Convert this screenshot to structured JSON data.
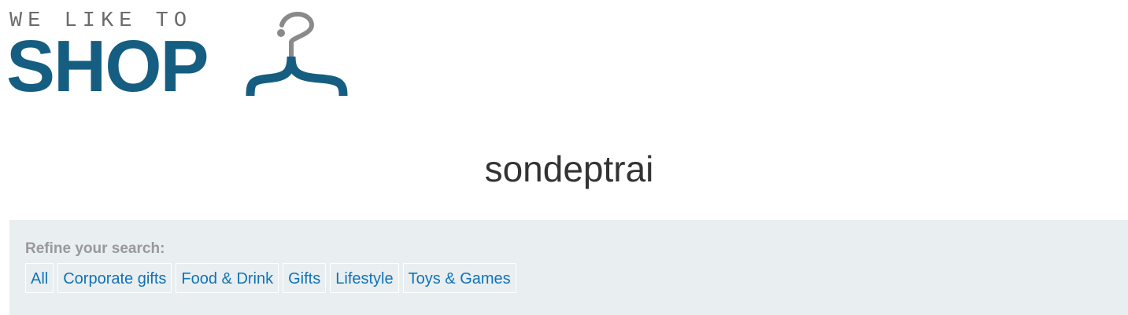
{
  "logo": {
    "top_text": "WE LIKE TO",
    "main_text": "SHOP",
    "icon": "hanger-icon",
    "colors": {
      "main": "#155e82",
      "top": "#6b6b6b",
      "hook": "#8a8a8a"
    }
  },
  "search": {
    "term": "sondeptrai"
  },
  "filters": {
    "label": "Refine your search:",
    "items": [
      {
        "label": "All"
      },
      {
        "label": "Corporate gifts"
      },
      {
        "label": "Food & Drink"
      },
      {
        "label": "Gifts"
      },
      {
        "label": "Lifestyle"
      },
      {
        "label": "Toys & Games"
      }
    ],
    "link_color": "#1173b6",
    "panel_color": "#e9eef1"
  }
}
